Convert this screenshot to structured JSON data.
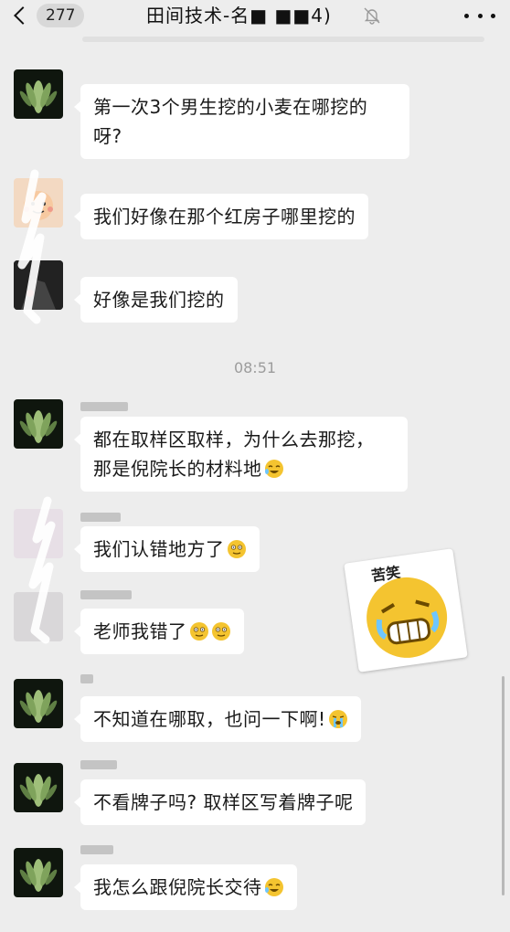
{
  "header": {
    "unread_count": "277",
    "title": "田间技术-名■   ■■4)"
  },
  "timestamp": "08:51",
  "messages": [
    {
      "text": "第一次3个男生挖的小麦在哪挖的\n呀?"
    },
    {
      "text": "我们好像在那个红房子哪里挖的"
    },
    {
      "text": "好像是我们挖的"
    },
    {
      "text_line1": "都在取样区取样，为什么去那挖，",
      "text_line2": "那是倪院长的材料地",
      "emoji": "laughing-tears-emoji"
    },
    {
      "text": "我们认错地方了",
      "emoji": "awkward-smile-emoji"
    },
    {
      "text": "老师我错了",
      "emoji": "awkward-smile-emoji"
    },
    {
      "text": "不知道在哪取，也问一下啊!",
      "emoji": "crying-emoji"
    },
    {
      "text": "不看牌子吗? 取样区写着牌子呢"
    },
    {
      "text": "我怎么跟倪院长交待",
      "emoji": "laughing-tears-emoji"
    }
  ],
  "sticker": {
    "label": "苦笑",
    "icon": "bitter-laugh-sticker"
  },
  "colors": {
    "background": "#ededed",
    "bubble": "#ffffff",
    "text": "#1a1a1a",
    "timestamp": "#9c9c9c",
    "emoji_yellow": "#f4c430"
  }
}
